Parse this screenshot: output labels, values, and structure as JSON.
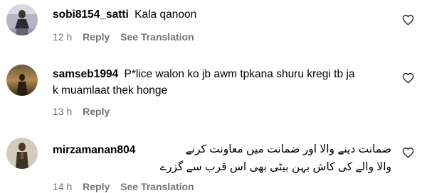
{
  "comments": [
    {
      "username": "sobi8154_satti",
      "text_lines": [
        "Kala qanoon"
      ],
      "time": "12 h",
      "reply": "Reply",
      "translation": "See Translation",
      "avatar_icon": "user-avatar-photo"
    },
    {
      "username": "samseb1994",
      "text_lines": [
        "P*lice walon ko jb awm tpkana shuru kregi tb ja",
        "k muamlaat thek honge"
      ],
      "time": "13 h",
      "reply": "Reply",
      "avatar_icon": "user-avatar-photo"
    },
    {
      "username": "mirzamanan804",
      "text_lines": [
        "ضمانت دینے والا اور ضمانت میں معاونت کرنے",
        "والا والے کی کاش بہن بیٹی بھی اس قرب سے گزرے"
      ],
      "time": "14 h",
      "reply": "Reply",
      "translation": "See Translation",
      "avatar_icon": "user-avatar-photo"
    }
  ],
  "icons": {
    "like": "heart-outline-icon"
  },
  "colors": {
    "text": "#000000",
    "meta": "#737373",
    "background": "#ffffff"
  }
}
